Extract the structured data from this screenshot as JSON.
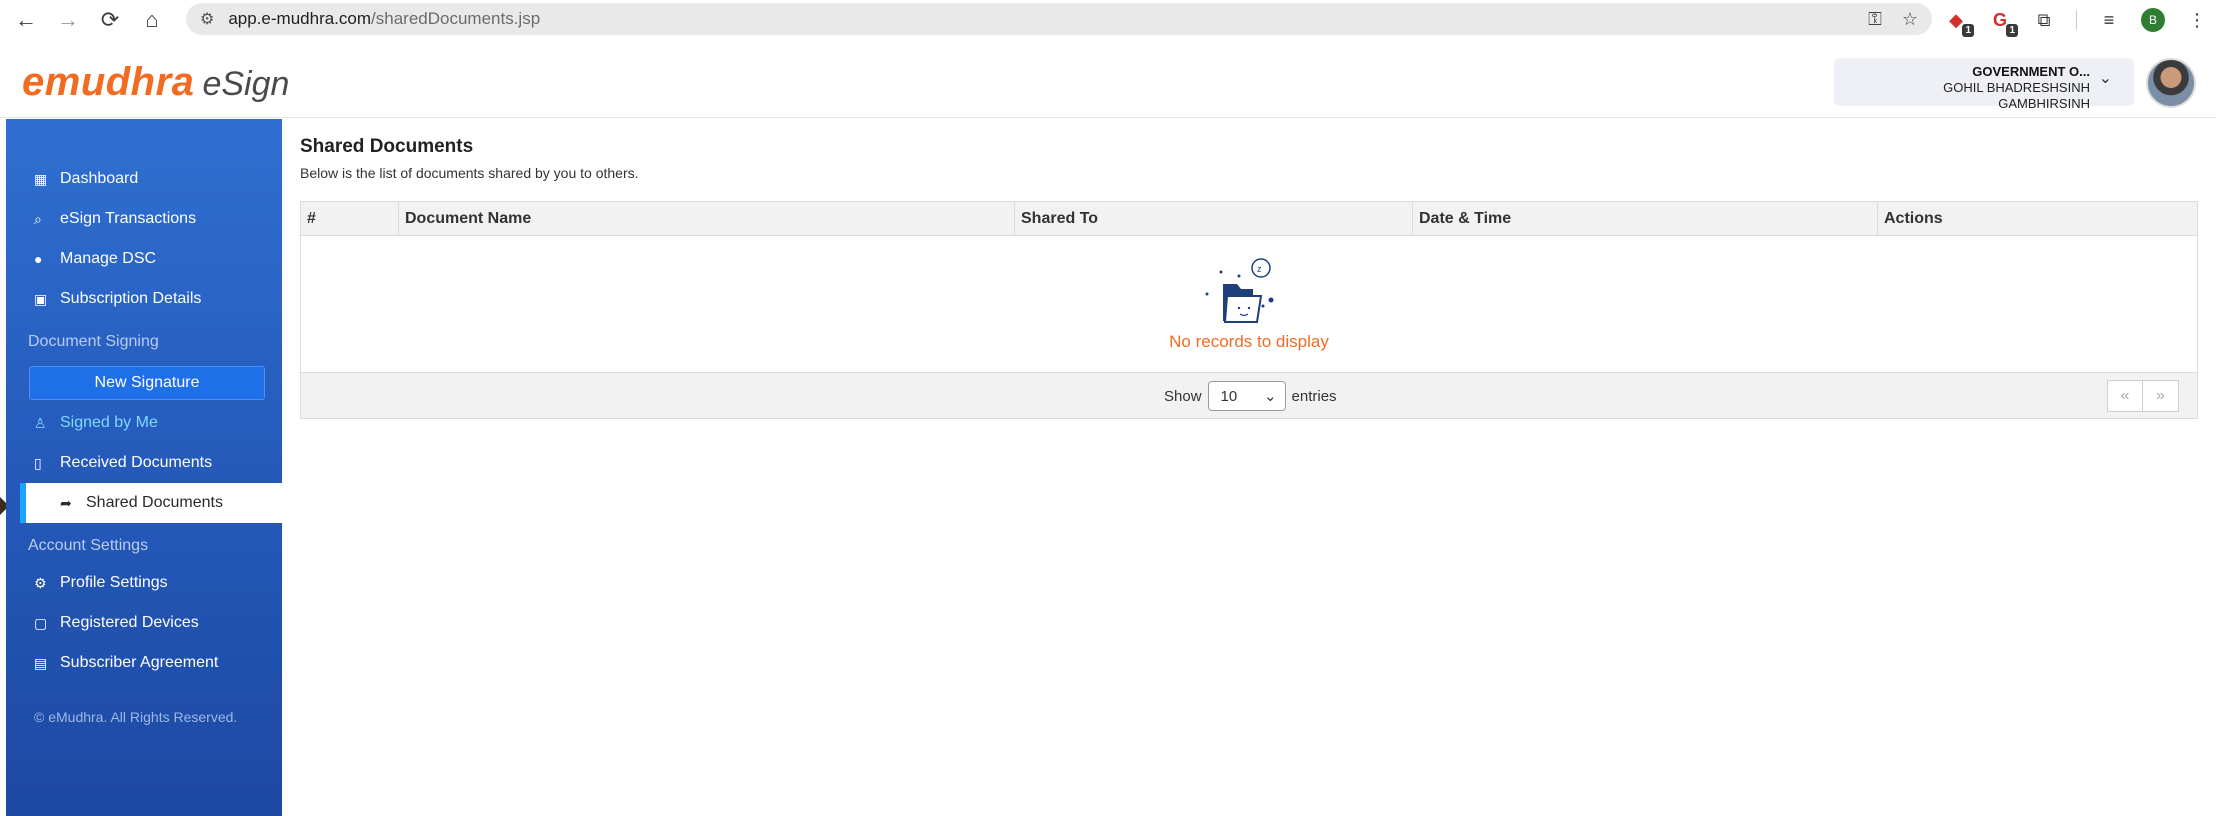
{
  "browser": {
    "url_host": "app.e-mudhra.com",
    "url_path": "/sharedDocuments.jsp",
    "ext_badge_1": "1",
    "ext_badge_2": "1",
    "profile_initial": "B"
  },
  "header": {
    "logo_main": "emudhra",
    "logo_sub": "eSign",
    "user_org": "GOVERNMENT O...",
    "user_name": "GOHIL BHADRESHSINH GAMBHIRSINH"
  },
  "sidebar": {
    "items": [
      {
        "label": "Dashboard",
        "icon": "dashboard-icon"
      },
      {
        "label": "eSign Transactions",
        "icon": "search-icon"
      },
      {
        "label": "Manage DSC",
        "icon": "circle-icon"
      },
      {
        "label": "Subscription Details",
        "icon": "id-card-icon"
      }
    ],
    "section_document_signing": "Document Signing",
    "new_signature": "New Signature",
    "signed_by_me": "Signed by Me",
    "received_documents": "Received Documents",
    "shared_documents": "Shared Documents",
    "section_account_settings": "Account Settings",
    "profile_settings": "Profile Settings",
    "registered_devices": "Registered Devices",
    "subscriber_agreement": "Subscriber Agreement",
    "footer": "© eMudhra. All Rights Reserved."
  },
  "main": {
    "title": "Shared Documents",
    "subtitle": "Below is the list of documents shared by you to others.",
    "columns": [
      "#",
      "Document Name",
      "Shared To",
      "Date & Time",
      "Actions"
    ],
    "empty_text": "No records to display",
    "show_label": "Show",
    "page_size": "10",
    "entries_label": "entries",
    "prev": "«",
    "next": "»"
  }
}
